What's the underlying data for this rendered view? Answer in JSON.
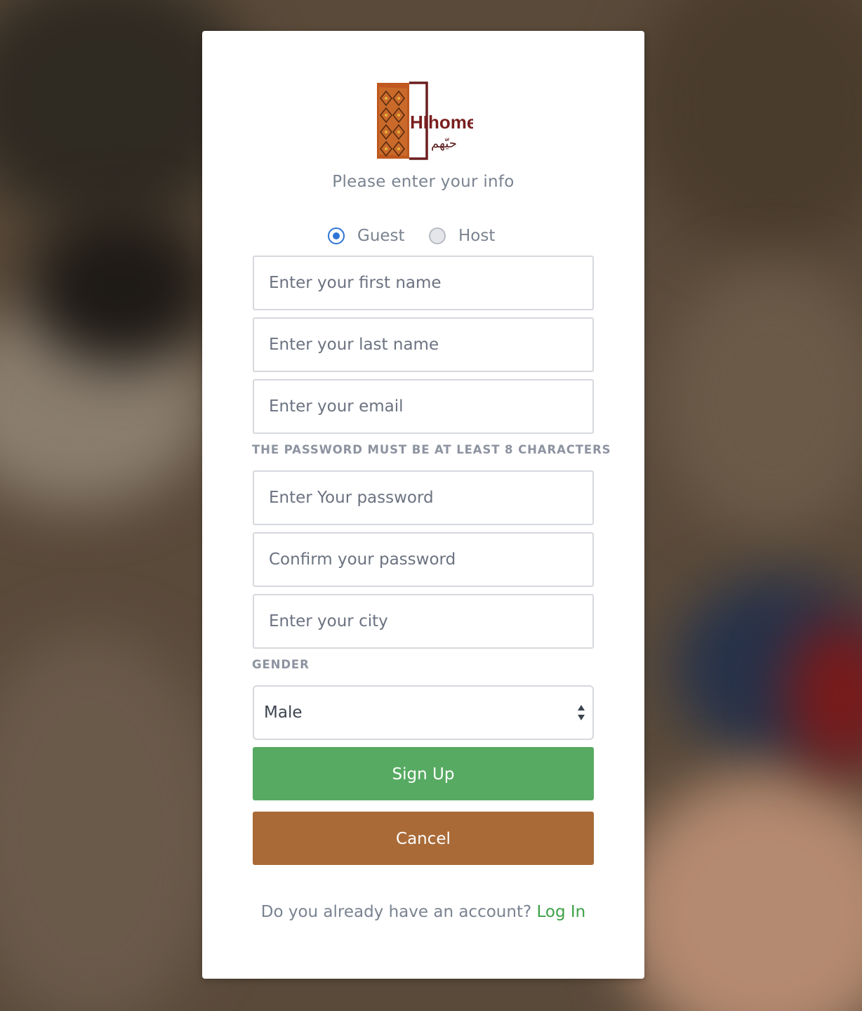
{
  "brand": {
    "logo_text": "HIhome",
    "logo_arabic": "حيّهم"
  },
  "form": {
    "subtitle": "Please enter your info",
    "roles": [
      {
        "label": "Guest",
        "checked": true
      },
      {
        "label": "Host",
        "checked": false
      }
    ],
    "fields": {
      "first_name": {
        "placeholder": "Enter your first name",
        "value": ""
      },
      "last_name": {
        "placeholder": "Enter your last name",
        "value": ""
      },
      "email": {
        "placeholder": "Enter your email",
        "value": ""
      },
      "password": {
        "placeholder": "Enter Your password",
        "value": ""
      },
      "confirm_password": {
        "placeholder": "Confirm your password",
        "value": ""
      },
      "city": {
        "placeholder": "Enter your city",
        "value": ""
      }
    },
    "password_hint": "THE PASSWORD MUST BE AT LEAST 8 CHARACTERS",
    "gender": {
      "label": "GENDER",
      "selected": "Male"
    },
    "signup_label": "Sign Up",
    "cancel_label": "Cancel"
  },
  "footer": {
    "question": "Do you already have an account?",
    "login_label": "Log In"
  },
  "colors": {
    "accent_blue": "#2d74d6",
    "signup_green": "#57aa62",
    "cancel_brown": "#a96a37",
    "link_green": "#3ca146"
  }
}
